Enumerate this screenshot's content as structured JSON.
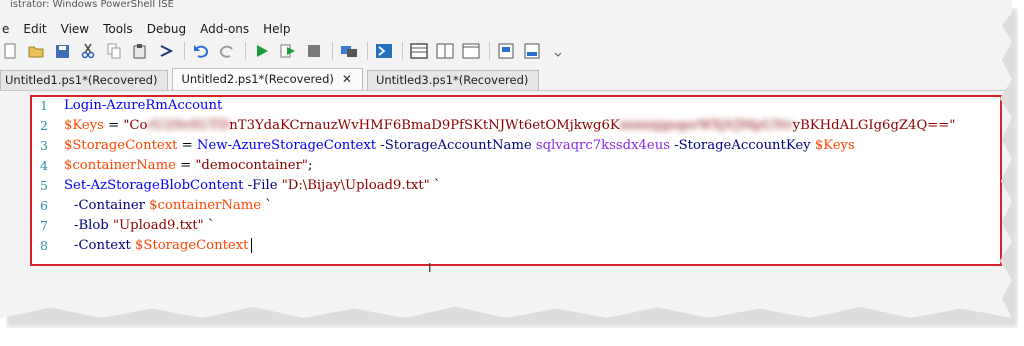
{
  "window": {
    "title": "istrator: Windows PowerShell ISE"
  },
  "menu": [
    "e",
    "Edit",
    "View",
    "Tools",
    "Debug",
    "Add-ons",
    "Help"
  ],
  "toolbar": {
    "buttons": [
      "new-icon",
      "open-icon",
      "save-icon",
      "cut-icon",
      "copy-icon",
      "paste-icon",
      "clear-icon",
      "undo-icon",
      "redo-icon",
      "run-icon",
      "run-selection-icon",
      "stop-icon",
      "remote-icon",
      "powershell-icon",
      "layout-top-icon",
      "layout-right-icon",
      "layout-max-icon",
      "show-script-icon",
      "show-commands-icon"
    ]
  },
  "tabs": [
    {
      "label": "Untitled1.ps1*(Recovered)",
      "active": false
    },
    {
      "label": "Untitled2.ps1*(Recovered)",
      "active": true,
      "close": "✕"
    },
    {
      "label": "Untitled3.ps1*(Recovered)",
      "active": false
    }
  ],
  "editor": {
    "lines": [
      {
        "n": "1",
        "t1": "Login-AzureRmAccount"
      },
      {
        "n": "2",
        "t1": "$Keys",
        "t2": " = ",
        "t3": "\"Co",
        "t4": "nT3YdaKCrnauzWvHMF6BmaD9PfSKtNJWt6etOMjkwg6K",
        "t5": "yBKHdALGIg6gZ4Q==\""
      },
      {
        "n": "3",
        "t1": "$StorageContext",
        "t2": " = ",
        "t3": "New-AzureStorageContext",
        "t4": " -StorageAccountName ",
        "t5": "sqlvaqrc7kssdx4eus",
        "t6": " -StorageAccountKey ",
        "t7": "$Keys"
      },
      {
        "n": "4",
        "t1": "$containerName",
        "t2": " = ",
        "t3": "\"democontainer\"",
        "t4": ";"
      },
      {
        "n": "5",
        "t1": "Set-AzStorageBlobContent",
        "t2": " -File ",
        "t3": "\"D:\\Bijay\\Upload9.txt\"",
        "t4": " `"
      },
      {
        "n": "6",
        "t1": "-Container ",
        "t2": "$containerName",
        "t3": " `"
      },
      {
        "n": "7",
        "t1": "-Blob ",
        "t2": "\"Upload9.txt\"",
        "t3": " `"
      },
      {
        "n": "8",
        "t1": "-Context ",
        "t2": "$StorageContext"
      }
    ]
  },
  "colors": {
    "border": "#d9232b",
    "cmdlet": "#0000ff",
    "variable": "#ff4500",
    "string": "#8b0000",
    "param": "#000080"
  }
}
